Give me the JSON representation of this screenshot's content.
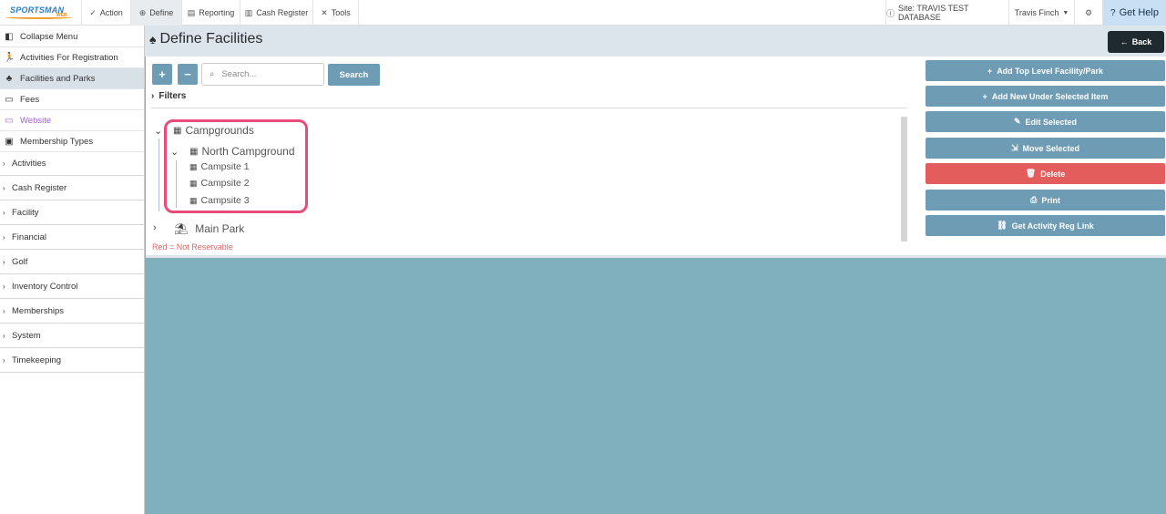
{
  "topbar": {
    "logo_main": "SPORTSMAN",
    "logo_sub": "WEB",
    "nav": [
      {
        "label": "Action",
        "icon": "check-icon"
      },
      {
        "label": "Define",
        "icon": "plus-circle-icon"
      },
      {
        "label": "Reporting",
        "icon": "document-icon"
      },
      {
        "label": "Cash Register",
        "icon": "cash-register-icon"
      },
      {
        "label": "Tools",
        "icon": "tools-icon"
      }
    ],
    "site_label": "Site: TRAVIS TEST DATABASE",
    "user_name": "Travis Finch",
    "help_label": "Get Help"
  },
  "sidebar": {
    "items": [
      {
        "label": "Collapse Menu",
        "icon": "collapse-icon"
      },
      {
        "label": "Activities For Registration",
        "icon": "runner-icon"
      },
      {
        "label": "Facilities and Parks",
        "icon": "trees-icon"
      },
      {
        "label": "Fees",
        "icon": "money-icon"
      },
      {
        "label": "Website",
        "icon": "browser-icon"
      },
      {
        "label": "Membership Types",
        "icon": "id-card-icon"
      }
    ],
    "groups": [
      "Activities",
      "Cash Register",
      "Facility",
      "Financial",
      "Golf",
      "Inventory Control",
      "Memberships",
      "System",
      "Timekeeping"
    ]
  },
  "page": {
    "title": "Define Facilities",
    "back_label": "Back"
  },
  "toolbar": {
    "expand_label": "+",
    "collapse_label": "−",
    "search_placeholder": "Search...",
    "search_button": "Search",
    "filters_label": "Filters"
  },
  "tree": {
    "campgrounds": "Campgrounds",
    "north_campground": "North Campground",
    "campsites": [
      "Campsite 1",
      "Campsite 2",
      "Campsite 3"
    ],
    "main_park": "Main Park",
    "legend": "Red = Not Reservable"
  },
  "actions": [
    {
      "label": "Add Top Level Facility/Park",
      "icon": "plus-icon"
    },
    {
      "label": "Add New Under Selected Item",
      "icon": "plus-icon"
    },
    {
      "label": "Edit Selected",
      "icon": "pencil-icon"
    },
    {
      "label": "Move Selected",
      "icon": "pointer-icon"
    },
    {
      "label": "Delete",
      "icon": "trash-icon"
    },
    {
      "label": "Print",
      "icon": "printer-icon"
    },
    {
      "label": "Get Activity Reg Link",
      "icon": "link-icon"
    }
  ],
  "colors": {
    "accent": "#6e9cb4",
    "danger": "#e35d5d",
    "highlight": "#e94c79",
    "content_bg": "#80b0be"
  }
}
